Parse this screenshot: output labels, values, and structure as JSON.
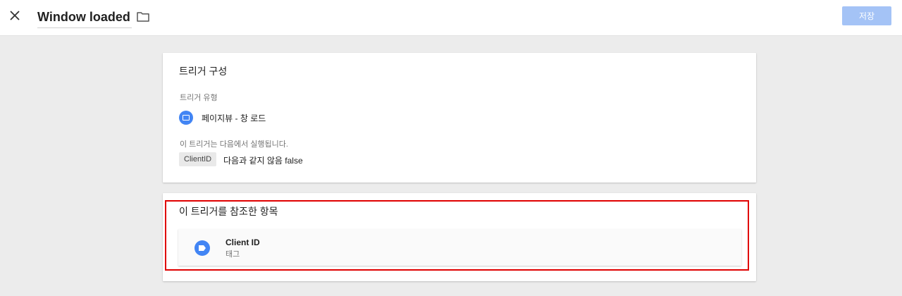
{
  "header": {
    "title": "Window loaded",
    "save_label": "저장",
    "close_icon": "close-icon",
    "folder_icon": "folder-icon"
  },
  "trigger_config": {
    "heading": "트리거 구성",
    "type_label": "트리거 유형",
    "type_value": "페이지뷰 - 창 로드",
    "fires_on_label": "이 트리거는 다음에서 실행됩니다.",
    "condition": {
      "variable": "ClientID",
      "rule": "다음과 같지 않음 false"
    }
  },
  "references": {
    "heading": "이 트리거를 참조한 항목",
    "items": [
      {
        "name": "Client ID",
        "type": "태그",
        "icon": "tag-icon"
      }
    ]
  },
  "colors": {
    "accent": "#4285f4",
    "save_disabled": "#a4c3f6",
    "highlight": "#e00000"
  }
}
